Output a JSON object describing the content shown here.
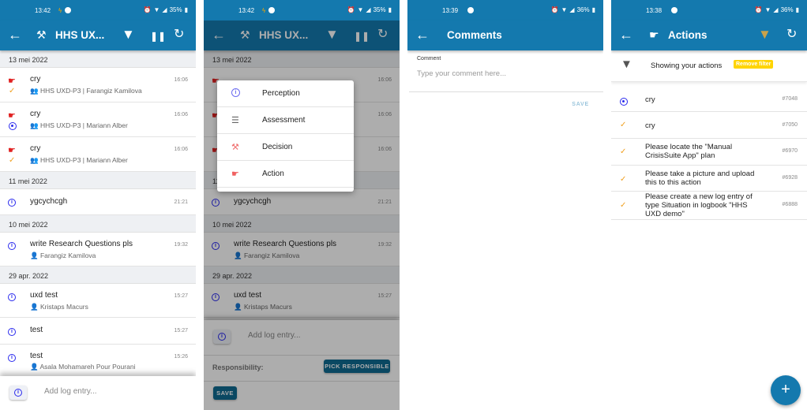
{
  "screens": [
    {
      "status": {
        "time": "13:42",
        "battery": "35%"
      },
      "appbar": {
        "title": "HHS UX...",
        "back": "←",
        "title_icon": "gavel-icon",
        "filter": "▼",
        "pause": "❚❚",
        "refresh": "↻"
      },
      "groups": [
        {
          "date": "13 mei 2022",
          "entries": [
            {
              "title": "cry",
              "sub": "HHS UXD-P3 | Farangiz Kamilova",
              "time": "16:06",
              "type": "action",
              "status": "done",
              "sub_icon": "group"
            },
            {
              "title": "cry",
              "sub": "HHS UXD-P3 | Mariann Alber",
              "time": "16:06",
              "type": "action",
              "status": "in-progress",
              "sub_icon": "group"
            },
            {
              "title": "cry",
              "sub": "HHS UXD-P3 | Mariann Alber",
              "time": "16:06",
              "type": "action",
              "status": "done",
              "sub_icon": "group"
            }
          ]
        },
        {
          "date": "11 mei 2022",
          "entries": [
            {
              "title": "ygcychcgh",
              "sub": "",
              "time": "21:21",
              "type": "perception"
            }
          ]
        },
        {
          "date": "10 mei 2022",
          "entries": [
            {
              "title": "write Research Questions pls",
              "sub": "Farangiz Kamilova",
              "time": "19:32",
              "type": "perception",
              "sub_icon": "person"
            }
          ]
        },
        {
          "date": "29 apr. 2022",
          "entries": [
            {
              "title": "uxd test",
              "sub": "Kristaps Macurs",
              "time": "15:27",
              "type": "perception",
              "sub_icon": "person"
            },
            {
              "title": "test",
              "sub": "",
              "time": "15:27",
              "type": "perception"
            },
            {
              "title": "test",
              "sub": "Asala Mohamareh Pour Pourani",
              "time": "15:26",
              "type": "perception",
              "sub_icon": "person"
            }
          ]
        }
      ],
      "add_entry_placeholder": "Add log entry..."
    },
    {
      "status": {
        "time": "13:42",
        "battery": "35%"
      },
      "appbar": {
        "title": "HHS UX...",
        "back": "←",
        "filter": "▼",
        "pause": "❚❚",
        "refresh": "↻"
      },
      "menu": [
        {
          "label": "Perception",
          "icon": "info-icon"
        },
        {
          "label": "Assessment",
          "icon": "list-icon"
        },
        {
          "label": "Decision",
          "icon": "gavel-icon"
        },
        {
          "label": "Action",
          "icon": "thumb-icon"
        }
      ],
      "add_entry_placeholder": "Add log entry...",
      "responsibility_label": "Responsibility:",
      "pick_responsible": "PICK RESPONSIBLE",
      "save": "SAVE"
    },
    {
      "status": {
        "time": "13:39",
        "battery": "36%"
      },
      "appbar": {
        "title": "Comments",
        "back": "←"
      },
      "comment_label": "Comment",
      "comment_placeholder": "Type your comment here...",
      "save": "SAVE"
    },
    {
      "status": {
        "time": "13:38",
        "battery": "36%"
      },
      "appbar": {
        "title": "Actions",
        "back": "←",
        "filter": "▼",
        "refresh": "↻"
      },
      "filter_text": "Showing your actions",
      "remove_filter": "Remove filter",
      "actions": [
        {
          "text": "cry",
          "id": "#7048",
          "status": "in-progress"
        },
        {
          "text": "cry",
          "id": "#7050",
          "status": "done"
        },
        {
          "text": "Please locate the \"Manual CrisisSuite App\" plan",
          "id": "#6970",
          "status": "done"
        },
        {
          "text": "Please take a picture and upload this to this action",
          "id": "#6928",
          "status": "done"
        },
        {
          "text": "Please create a new log entry of type Situation in logbook \"HHS UXD demo\"",
          "id": "#6888",
          "status": "done"
        }
      ],
      "fab": "+"
    }
  ],
  "colors": {
    "primary": "#1479ae",
    "dark_primary": "#0f6a91",
    "filter_active": "#c9a24a",
    "badge": "#ffd400",
    "done": "#f0a020",
    "info": "#2a2aee",
    "action": "#e02020"
  }
}
